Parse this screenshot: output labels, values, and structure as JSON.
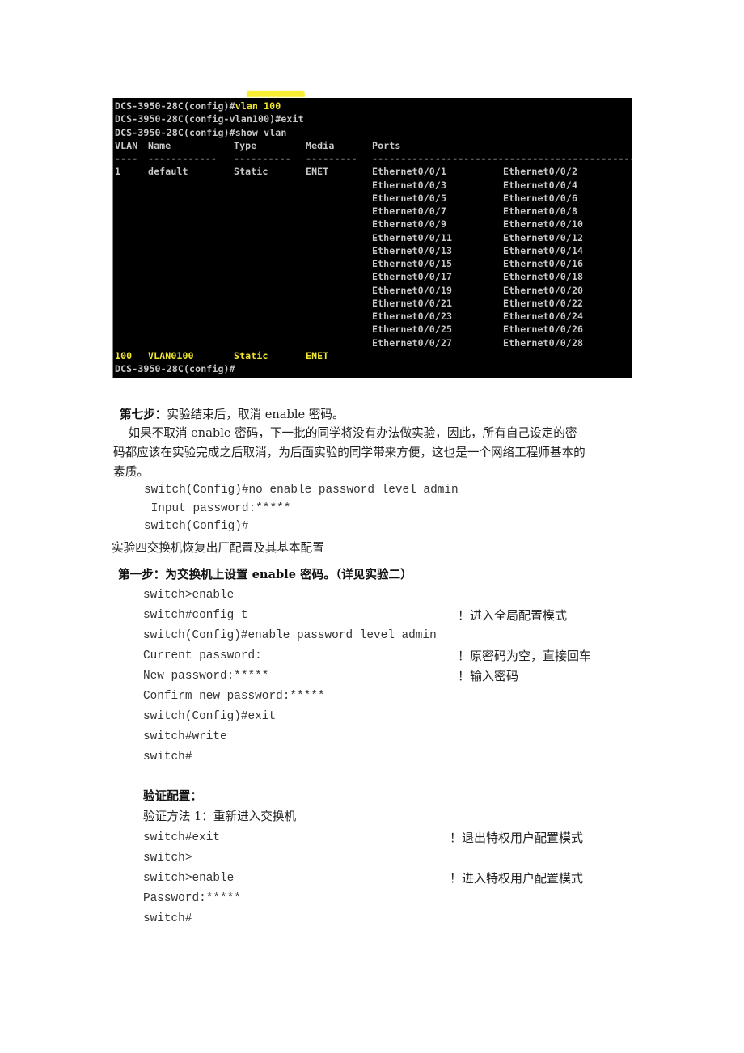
{
  "terminal": {
    "highlight_color": "#f7ee33",
    "text_color": "#c8c8c8",
    "accent_text_color": "#f0e62a",
    "commands": [
      {
        "prompt": "DCS-3950-28C(config)#",
        "command": "vlan 100",
        "highlighted": true
      },
      {
        "prompt": "DCS-3950-28C(config-vlan100)#",
        "command": "exit",
        "highlighted": false
      },
      {
        "prompt": "DCS-3950-28C(config)#",
        "command": "show vlan",
        "highlighted": false
      }
    ],
    "table_headers": {
      "vlan": "VLAN",
      "name": "Name",
      "type": "Type",
      "media": "Media",
      "ports": "Ports"
    },
    "table_dashes": {
      "vlan": "----",
      "name": "------------",
      "type": "----------",
      "media": "---------",
      "ports": "--------------------------------------------------"
    },
    "vlans": [
      {
        "vlan": "1",
        "name": "default",
        "type": "Static",
        "media": "ENET",
        "highlighted": false,
        "ports": [
          [
            "Ethernet0/0/1",
            "Ethernet0/0/2"
          ],
          [
            "Ethernet0/0/3",
            "Ethernet0/0/4"
          ],
          [
            "Ethernet0/0/5",
            "Ethernet0/0/6"
          ],
          [
            "Ethernet0/0/7",
            "Ethernet0/0/8"
          ],
          [
            "Ethernet0/0/9",
            "Ethernet0/0/10"
          ],
          [
            "Ethernet0/0/11",
            "Ethernet0/0/12"
          ],
          [
            "Ethernet0/0/13",
            "Ethernet0/0/14"
          ],
          [
            "Ethernet0/0/15",
            "Ethernet0/0/16"
          ],
          [
            "Ethernet0/0/17",
            "Ethernet0/0/18"
          ],
          [
            "Ethernet0/0/19",
            "Ethernet0/0/20"
          ],
          [
            "Ethernet0/0/21",
            "Ethernet0/0/22"
          ],
          [
            "Ethernet0/0/23",
            "Ethernet0/0/24"
          ],
          [
            "Ethernet0/0/25",
            "Ethernet0/0/26"
          ],
          [
            "Ethernet0/0/27",
            "Ethernet0/0/28"
          ]
        ]
      },
      {
        "vlan": "100",
        "name": "VLAN0100",
        "type": "Static",
        "media": "ENET",
        "highlighted": true,
        "ports": []
      }
    ],
    "final_prompt": "DCS-3950-28C(config)#"
  },
  "step7": {
    "heading": "第七步：",
    "heading_rest": "实验结束后，取消 enable 密码。",
    "paragraph_lines": [
      "    如果不取消 enable 密码，下一批的同学将没有办法做实验，因此，所有自己设定的密",
      "码都应该在实验完成之后取消，为后面实验的同学带来方便，这也是一个网络工程师基本的",
      "素质。"
    ],
    "code_lines": [
      "switch(Config)#no enable password level admin",
      " Input password:*****",
      "switch(Config)#"
    ]
  },
  "experiment4": {
    "title": "实验四交换机恢复出厂配置及其基本配置",
    "step1_heading": "第一步：为交换机上设置 enable 密码。（详见实验二）",
    "step1_lines": [
      {
        "code": "switch>enable",
        "comment": ""
      },
      {
        "code": "switch#config t",
        "comment": "！进入全局配置模式"
      },
      {
        "code": "switch(Config)#enable password level admin",
        "comment": ""
      },
      {
        "code": "Current password:",
        "comment": "！原密码为空，直接回车"
      },
      {
        "code": "New password:*****",
        "comment": "！输入密码"
      },
      {
        "code": "Confirm new password:*****",
        "comment": ""
      },
      {
        "code": "switch(Config)#exit",
        "comment": ""
      },
      {
        "code": "switch#write",
        "comment": ""
      },
      {
        "code": "switch#",
        "comment": ""
      }
    ],
    "verify_heading": "验证配置：",
    "verify_method": "验证方法 1：重新进入交换机",
    "verify_lines": [
      {
        "code": "switch#exit",
        "comment": "！退出特权用户配置模式"
      },
      {
        "code": "switch>",
        "comment": ""
      },
      {
        "code": "switch>enable",
        "comment": "！进入特权用户配置模式"
      },
      {
        "code": "Password:*****",
        "comment": ""
      },
      {
        "code": "switch#",
        "comment": ""
      }
    ]
  }
}
